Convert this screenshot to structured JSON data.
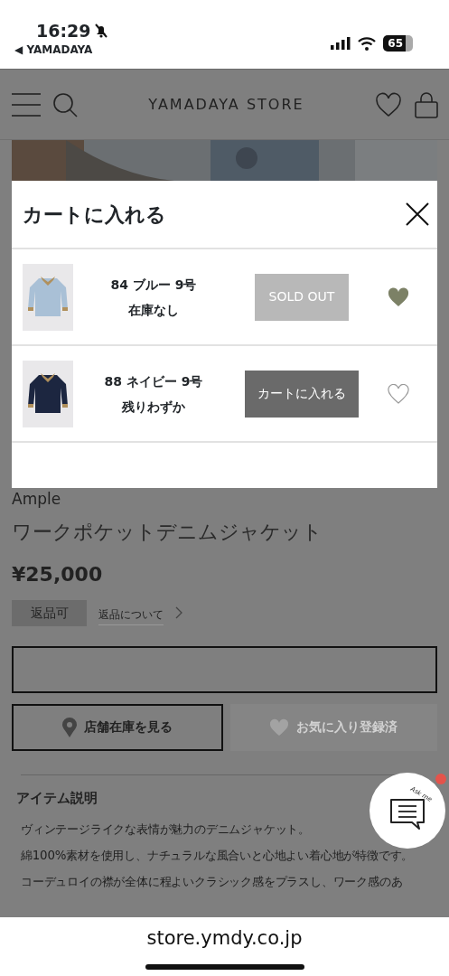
{
  "status_bar": {
    "time": "16:29",
    "back_app": "◀ YAMADAYA",
    "battery": "65"
  },
  "header": {
    "title": "YAMADAYA STORE"
  },
  "cart_dialog": {
    "title": "カートに入れる",
    "items": [
      {
        "kind": "picture",
        "variant": "84 ブルー 9号",
        "stock": "在庫なし",
        "button": "SOLD OUT",
        "disabled": true,
        "favorite": true
      },
      {
        "kind": "picture",
        "variant": "88 ネイビー 9号",
        "stock": "残りわずか",
        "button": "カートに入れる",
        "disabled": false,
        "favorite": false
      }
    ]
  },
  "product": {
    "brand": "Ample",
    "name": "ワークポケットデニムジャケット",
    "price": "¥25,000",
    "return_badge": "返品可",
    "return_link": "返品について",
    "store_stock_button": "店舗在庫を見る",
    "favorite_button": {
      "label": "お気に入り登録済",
      "disabled": true
    }
  },
  "description": {
    "title": "アイテム説明",
    "paragraphs": [
      "ヴィンテージライクな表情が魅力のデニムジャケット。",
      "綿100%素材を使用し、ナチュラルな風合いと心地よい着心地が特徴です。",
      "コーデュロイの襟が全体に程よいクラシック感をプラスし、ワーク感のあ"
    ]
  },
  "chat": {
    "label": "Ask me",
    "unread": true
  },
  "address_bar": {
    "url": "store.ymdy.co.jp"
  }
}
